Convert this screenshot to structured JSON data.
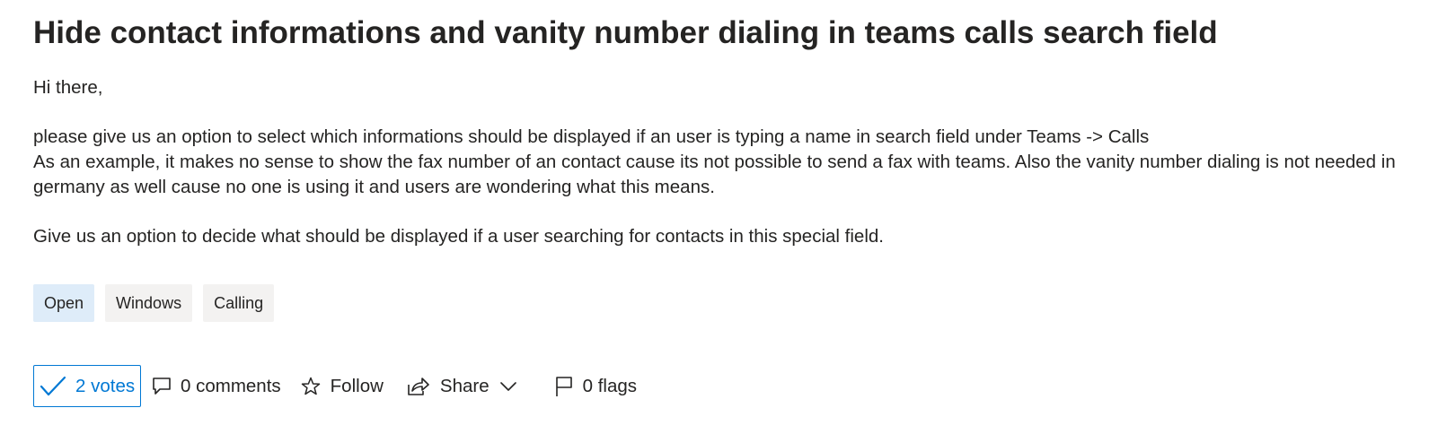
{
  "idea": {
    "title": "Hide contact informations and vanity number dialing in teams calls search field",
    "body": {
      "greeting": "Hi there,",
      "line1": "please give us an option to select which informations should be displayed if an user is typing a name in search field under Teams -> Calls",
      "line2": "As an example, it makes no sense to show the fax number of an contact cause its not possible to send a fax with teams. Also the vanity number dialing is not needed in",
      "line3": "germany as well cause no one is using it and users are wondering what this means.",
      "line4": "Give us an option to decide what should be displayed if a user searching for contacts in this special field."
    },
    "tags": {
      "status": "Open",
      "platform": "Windows",
      "category": "Calling"
    }
  },
  "actions": {
    "votes_label": "2 votes",
    "comments_label": "0 comments",
    "follow_label": "Follow",
    "share_label": "Share",
    "flags_label": "0 flags"
  },
  "icons": {
    "vote": "checkmark-icon",
    "comments": "comment-icon",
    "follow": "star-icon",
    "share": "share-icon",
    "share_menu": "chevron-down-icon",
    "flags": "flag-icon"
  },
  "colors": {
    "accent": "#0078d4",
    "text": "#252423",
    "status_tag_bg": "#deecf9",
    "tag_bg": "#f3f2f1"
  }
}
